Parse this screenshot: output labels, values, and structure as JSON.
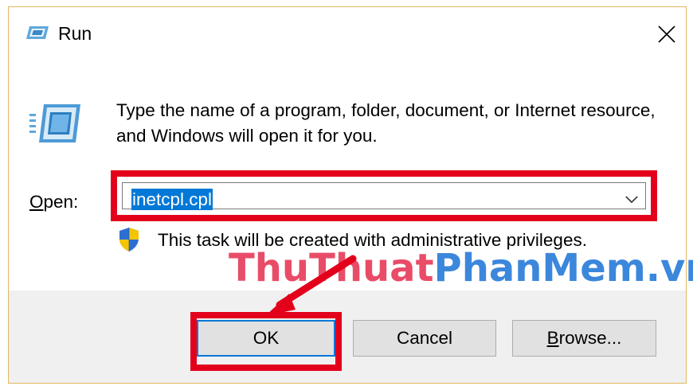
{
  "window": {
    "title": "Run",
    "close_icon": "close-icon",
    "app_icon": "run-app-icon"
  },
  "content": {
    "description": "Type the name of a program, folder, document, or Internet resource, and Windows will open it for you.",
    "open_label_mnemonic": "O",
    "open_label_rest": "pen:",
    "open_value": "inetcpl.cpl",
    "admin_note": "This task will be created with administrative privileges."
  },
  "watermark": {
    "part1": "ThuThuat",
    "part2": "PhanMem.vn"
  },
  "buttons": {
    "ok": "OK",
    "cancel": "Cancel",
    "browse_mnemonic": "B",
    "browse_rest": "rowse..."
  },
  "colors": {
    "highlight": "#e3001b",
    "selection": "#0078d7",
    "footer_bg": "#f0f0f0",
    "watermark_red": "#e62d4e",
    "watermark_blue": "#1a73d6"
  },
  "icons": [
    "run-app-icon",
    "run-large-icon",
    "close-icon",
    "chevron-down-icon",
    "uac-shield-icon",
    "annotation-arrow-icon"
  ]
}
